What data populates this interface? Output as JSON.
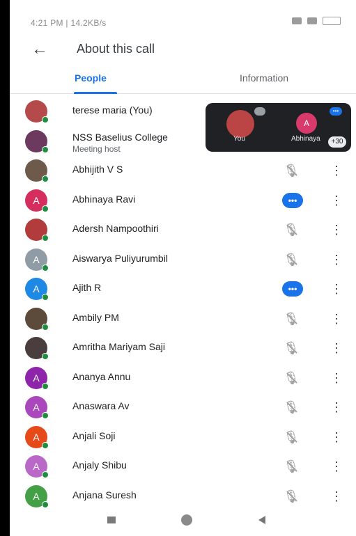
{
  "status_bar": {
    "left_text": "4:21 PM | 14.2KB/s"
  },
  "header": {
    "back_icon": "arrow-back-icon",
    "title": "About this call"
  },
  "tabs": [
    {
      "label": "People",
      "active": true
    },
    {
      "label": "Information",
      "active": false
    }
  ],
  "participants": [
    {
      "name": "terese maria (You)",
      "subtitle": "",
      "avatar_letter": "",
      "avatar_color": "#b54a4a",
      "mic": "none"
    },
    {
      "name": "NSS Baselius College",
      "subtitle": "Meeting host",
      "avatar_letter": "",
      "avatar_color": "#6b3a5e",
      "mic": "none"
    },
    {
      "name": "Abhijith V S",
      "subtitle": "",
      "avatar_letter": "",
      "avatar_color": "#6d5a4a",
      "mic": "muted"
    },
    {
      "name": "Abhinaya Ravi",
      "subtitle": "",
      "avatar_letter": "A",
      "avatar_color": "#d62d5f",
      "mic": "speaking"
    },
    {
      "name": "Adersh Nampoothiri",
      "subtitle": "",
      "avatar_letter": "",
      "avatar_color": "#b23b3b",
      "mic": "muted"
    },
    {
      "name": "Aiswarya Puliyurumbil",
      "subtitle": "",
      "avatar_letter": "A",
      "avatar_color": "#8f9ca6",
      "mic": "muted"
    },
    {
      "name": "Ajith R",
      "subtitle": "",
      "avatar_letter": "A",
      "avatar_color": "#1e88e5",
      "mic": "speaking"
    },
    {
      "name": "Ambily PM",
      "subtitle": "",
      "avatar_letter": "",
      "avatar_color": "#5c4a3a",
      "mic": "muted"
    },
    {
      "name": "Amritha Mariyam Saji",
      "subtitle": "",
      "avatar_letter": "",
      "avatar_color": "#4a3d3d",
      "mic": "muted"
    },
    {
      "name": "Ananya Annu",
      "subtitle": "",
      "avatar_letter": "A",
      "avatar_color": "#8e24aa",
      "mic": "muted"
    },
    {
      "name": "Anaswara Av",
      "subtitle": "",
      "avatar_letter": "A",
      "avatar_color": "#ab47bc",
      "mic": "muted"
    },
    {
      "name": "Anjali Soji",
      "subtitle": "",
      "avatar_letter": "A",
      "avatar_color": "#e64a19",
      "mic": "muted"
    },
    {
      "name": "Anjaly Shibu",
      "subtitle": "",
      "avatar_letter": "A",
      "avatar_color": "#ba68c8",
      "mic": "muted"
    },
    {
      "name": "Anjana Suresh",
      "subtitle": "",
      "avatar_letter": "A",
      "avatar_color": "#43a047",
      "mic": "muted"
    }
  ],
  "pip": {
    "you_label": "You",
    "other_letter": "A",
    "other_label": "Abhinaya",
    "count": "+30"
  },
  "colors": {
    "accent": "#1a73e8",
    "online_dot": "#1e8e3e"
  }
}
